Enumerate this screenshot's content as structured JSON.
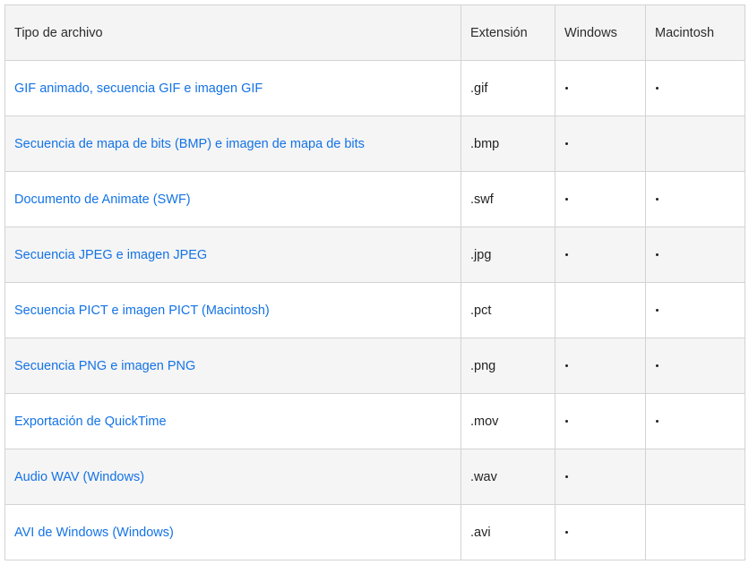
{
  "table": {
    "headers": {
      "type": "Tipo de archivo",
      "extension": "Extensión",
      "windows": "Windows",
      "mac": "Macintosh"
    },
    "rows": [
      {
        "type": "GIF animado, secuencia GIF e imagen GIF",
        "extension": ".gif",
        "windows": true,
        "mac": true
      },
      {
        "type": "Secuencia de mapa de bits (BMP) e imagen de mapa de bits",
        "extension": ".bmp",
        "windows": true,
        "mac": false
      },
      {
        "type": "Documento de Animate (SWF)",
        "extension": ".swf",
        "windows": true,
        "mac": true
      },
      {
        "type": "Secuencia JPEG e imagen JPEG",
        "extension": ".jpg",
        "windows": true,
        "mac": true
      },
      {
        "type": "Secuencia PICT e imagen PICT (Macintosh)",
        "extension": ".pct",
        "windows": false,
        "mac": true
      },
      {
        "type": "Secuencia PNG e imagen PNG",
        "extension": ".png",
        "windows": true,
        "mac": true
      },
      {
        "type": "Exportación de QuickTime",
        "extension": ".mov",
        "windows": true,
        "mac": true
      },
      {
        "type": "Audio WAV (Windows)",
        "extension": ".wav",
        "windows": true,
        "mac": false
      },
      {
        "type": "AVI de Windows (Windows)",
        "extension": ".avi",
        "windows": true,
        "mac": false
      }
    ],
    "link_color": "#1473e6",
    "support_marker_icon": "bullet-dot-icon"
  }
}
